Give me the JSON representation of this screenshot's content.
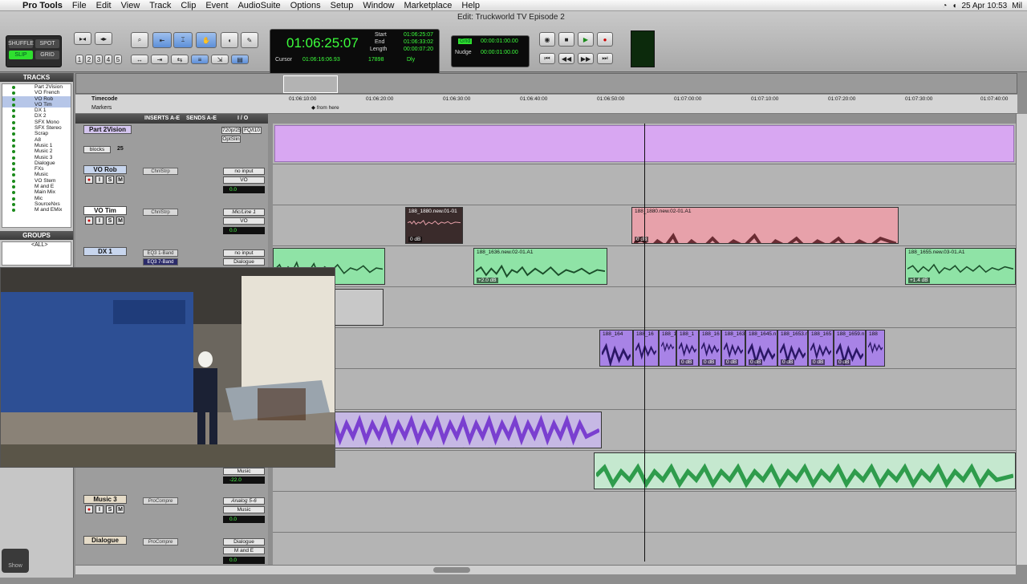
{
  "menu": {
    "app": "Pro Tools",
    "items": [
      "File",
      "Edit",
      "View",
      "Track",
      "Clip",
      "Event",
      "AudioSuite",
      "Options",
      "Setup",
      "Window",
      "Marketplace",
      "Help"
    ],
    "clock": "25 Apr  10:53",
    "user": "Mil"
  },
  "window_title": "Edit: Truckworld TV Episode 2",
  "toolbar": {
    "modes": [
      "SHUFFLE",
      "SPOT",
      "SLIP",
      "GRID"
    ],
    "counter": {
      "main": "01:06:25:07",
      "start_label": "Start",
      "start": "01:06:25:07",
      "end_label": "End",
      "end": "01:06:33:02",
      "length_label": "Length",
      "length": "00:00:07:20",
      "cursor_label": "Cursor",
      "cursor": "01:06:16:06.93",
      "sample": "17898",
      "dly": "Dly"
    },
    "grid_label": "Grid",
    "grid_value": "00:00:01:00.00",
    "nudge_label": "Nudge",
    "nudge_value": "00:00:01:00.00",
    "zoom_presets": [
      "1",
      "2",
      "3",
      "4",
      "5"
    ]
  },
  "sidebar": {
    "tracks_header": "TRACKS",
    "tracks": [
      "Part 2Vision",
      "VO French",
      "VO Rob",
      "VO Tim",
      "DX 1",
      "DX 2",
      "SFX Mono",
      "SFX Stereo",
      "Scrap",
      "A8",
      "Music 1",
      "Music 2",
      "Music 3",
      "Dialogue",
      "FXs",
      "Music",
      "VO Stem",
      "M and E",
      "Main Mix",
      "Mic",
      "SourceNxs",
      "M and EMix"
    ],
    "groups_header": "GROUPS",
    "groups_item": "<ALL>"
  },
  "ruler": {
    "timecode_label": "Timecode",
    "markers_label": "Markers",
    "marker": "from here",
    "ticks": [
      "01:06:10:00",
      "01:06:20:00",
      "01:06:30:00",
      "01:06:40:00",
      "01:06:50:00",
      "01:07:00:00",
      "01:07:10:00",
      "01:07:20:00",
      "01:07:30:00",
      "01:07:40:00"
    ]
  },
  "mix_headers": {
    "inserts": "INSERTS A-E",
    "sends": "SENDS A-E",
    "io": "I / O"
  },
  "mix_tracks": [
    {
      "name": "Part 2Vision",
      "io1": "720p/25",
      "io2": "FQ/t10",
      "io3": "OptSlin",
      "extra": "blocks",
      "num": "25"
    },
    {
      "name": "VO Rob",
      "insert": "ChnlStrp",
      "in": "no input",
      "out": "VO",
      "vol": "0.0"
    },
    {
      "name": "VO Tim",
      "insert": "ChnlStrp",
      "in": "Mic/Line 1",
      "out": "VO",
      "vol": "0.0"
    },
    {
      "name": "DX 1",
      "insert": "EQ3 1-Band",
      "insert2": "EQ3 7-Band",
      "in": "no input",
      "out": "Dialogue"
    },
    {
      "name": "Music 3",
      "insert": "ProCompre",
      "in": "Analog 5-6",
      "out": "Music",
      "vol": "0.0"
    },
    {
      "name": "Dialogue",
      "insert": "ProCompre",
      "in": "Dialogue",
      "out": "M and E",
      "vol": "0.0"
    }
  ],
  "hidden_track_out": "Music",
  "hidden_track_vol": "-22.0",
  "clips": {
    "tim1": {
      "name": "188_1880.new.01-01",
      "gain": "0 dB"
    },
    "tim2": {
      "name": "188_1880.new.02-01.A1",
      "gain": "0 dB"
    },
    "dx_a": {
      "gain": ""
    },
    "dx_b": {
      "name": "188_1636.new.02-01.A1",
      "gain": "+2.0 dB"
    },
    "dx_c": {
      "name": "188_1655.new.03-01.A1",
      "gain": "+1.4 dB"
    },
    "sfx": [
      "188_164",
      "188_16",
      "188_1",
      "188_1",
      "188_16",
      "188_163",
      "188_1645.n",
      "188_1653.n",
      "188_165",
      "188_1659.n",
      "188"
    ],
    "sfx_gain": "0 dB"
  },
  "show_button": "Show",
  "colors": {
    "video": "#d8a7f2",
    "vo_tim_clip": "#e7a1aa",
    "dx_clip": "#8fe3a6",
    "sfx_clip": "#a883e6",
    "music_clip": "#9b6ee0",
    "stem_clip": "#79d68e"
  }
}
